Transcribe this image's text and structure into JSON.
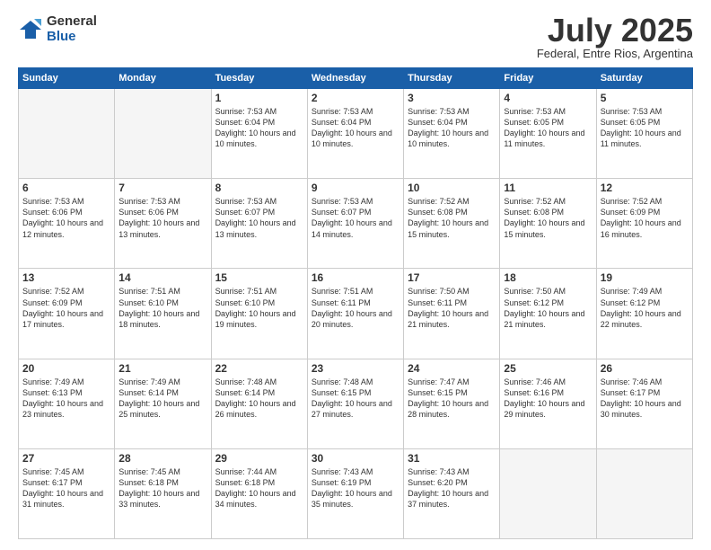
{
  "logo": {
    "general": "General",
    "blue": "Blue"
  },
  "title": "July 2025",
  "subtitle": "Federal, Entre Rios, Argentina",
  "days": [
    "Sunday",
    "Monday",
    "Tuesday",
    "Wednesday",
    "Thursday",
    "Friday",
    "Saturday"
  ],
  "weeks": [
    [
      {
        "day": "",
        "text": ""
      },
      {
        "day": "",
        "text": ""
      },
      {
        "day": "1",
        "text": "Sunrise: 7:53 AM\nSunset: 6:04 PM\nDaylight: 10 hours\nand 10 minutes."
      },
      {
        "day": "2",
        "text": "Sunrise: 7:53 AM\nSunset: 6:04 PM\nDaylight: 10 hours\nand 10 minutes."
      },
      {
        "day": "3",
        "text": "Sunrise: 7:53 AM\nSunset: 6:04 PM\nDaylight: 10 hours\nand 10 minutes."
      },
      {
        "day": "4",
        "text": "Sunrise: 7:53 AM\nSunset: 6:05 PM\nDaylight: 10 hours\nand 11 minutes."
      },
      {
        "day": "5",
        "text": "Sunrise: 7:53 AM\nSunset: 6:05 PM\nDaylight: 10 hours\nand 11 minutes."
      }
    ],
    [
      {
        "day": "6",
        "text": "Sunrise: 7:53 AM\nSunset: 6:06 PM\nDaylight: 10 hours\nand 12 minutes."
      },
      {
        "day": "7",
        "text": "Sunrise: 7:53 AM\nSunset: 6:06 PM\nDaylight: 10 hours\nand 13 minutes."
      },
      {
        "day": "8",
        "text": "Sunrise: 7:53 AM\nSunset: 6:07 PM\nDaylight: 10 hours\nand 13 minutes."
      },
      {
        "day": "9",
        "text": "Sunrise: 7:53 AM\nSunset: 6:07 PM\nDaylight: 10 hours\nand 14 minutes."
      },
      {
        "day": "10",
        "text": "Sunrise: 7:52 AM\nSunset: 6:08 PM\nDaylight: 10 hours\nand 15 minutes."
      },
      {
        "day": "11",
        "text": "Sunrise: 7:52 AM\nSunset: 6:08 PM\nDaylight: 10 hours\nand 15 minutes."
      },
      {
        "day": "12",
        "text": "Sunrise: 7:52 AM\nSunset: 6:09 PM\nDaylight: 10 hours\nand 16 minutes."
      }
    ],
    [
      {
        "day": "13",
        "text": "Sunrise: 7:52 AM\nSunset: 6:09 PM\nDaylight: 10 hours\nand 17 minutes."
      },
      {
        "day": "14",
        "text": "Sunrise: 7:51 AM\nSunset: 6:10 PM\nDaylight: 10 hours\nand 18 minutes."
      },
      {
        "day": "15",
        "text": "Sunrise: 7:51 AM\nSunset: 6:10 PM\nDaylight: 10 hours\nand 19 minutes."
      },
      {
        "day": "16",
        "text": "Sunrise: 7:51 AM\nSunset: 6:11 PM\nDaylight: 10 hours\nand 20 minutes."
      },
      {
        "day": "17",
        "text": "Sunrise: 7:50 AM\nSunset: 6:11 PM\nDaylight: 10 hours\nand 21 minutes."
      },
      {
        "day": "18",
        "text": "Sunrise: 7:50 AM\nSunset: 6:12 PM\nDaylight: 10 hours\nand 21 minutes."
      },
      {
        "day": "19",
        "text": "Sunrise: 7:49 AM\nSunset: 6:12 PM\nDaylight: 10 hours\nand 22 minutes."
      }
    ],
    [
      {
        "day": "20",
        "text": "Sunrise: 7:49 AM\nSunset: 6:13 PM\nDaylight: 10 hours\nand 23 minutes."
      },
      {
        "day": "21",
        "text": "Sunrise: 7:49 AM\nSunset: 6:14 PM\nDaylight: 10 hours\nand 25 minutes."
      },
      {
        "day": "22",
        "text": "Sunrise: 7:48 AM\nSunset: 6:14 PM\nDaylight: 10 hours\nand 26 minutes."
      },
      {
        "day": "23",
        "text": "Sunrise: 7:48 AM\nSunset: 6:15 PM\nDaylight: 10 hours\nand 27 minutes."
      },
      {
        "day": "24",
        "text": "Sunrise: 7:47 AM\nSunset: 6:15 PM\nDaylight: 10 hours\nand 28 minutes."
      },
      {
        "day": "25",
        "text": "Sunrise: 7:46 AM\nSunset: 6:16 PM\nDaylight: 10 hours\nand 29 minutes."
      },
      {
        "day": "26",
        "text": "Sunrise: 7:46 AM\nSunset: 6:17 PM\nDaylight: 10 hours\nand 30 minutes."
      }
    ],
    [
      {
        "day": "27",
        "text": "Sunrise: 7:45 AM\nSunset: 6:17 PM\nDaylight: 10 hours\nand 31 minutes."
      },
      {
        "day": "28",
        "text": "Sunrise: 7:45 AM\nSunset: 6:18 PM\nDaylight: 10 hours\nand 33 minutes."
      },
      {
        "day": "29",
        "text": "Sunrise: 7:44 AM\nSunset: 6:18 PM\nDaylight: 10 hours\nand 34 minutes."
      },
      {
        "day": "30",
        "text": "Sunrise: 7:43 AM\nSunset: 6:19 PM\nDaylight: 10 hours\nand 35 minutes."
      },
      {
        "day": "31",
        "text": "Sunrise: 7:43 AM\nSunset: 6:20 PM\nDaylight: 10 hours\nand 37 minutes."
      },
      {
        "day": "",
        "text": ""
      },
      {
        "day": "",
        "text": ""
      }
    ]
  ]
}
